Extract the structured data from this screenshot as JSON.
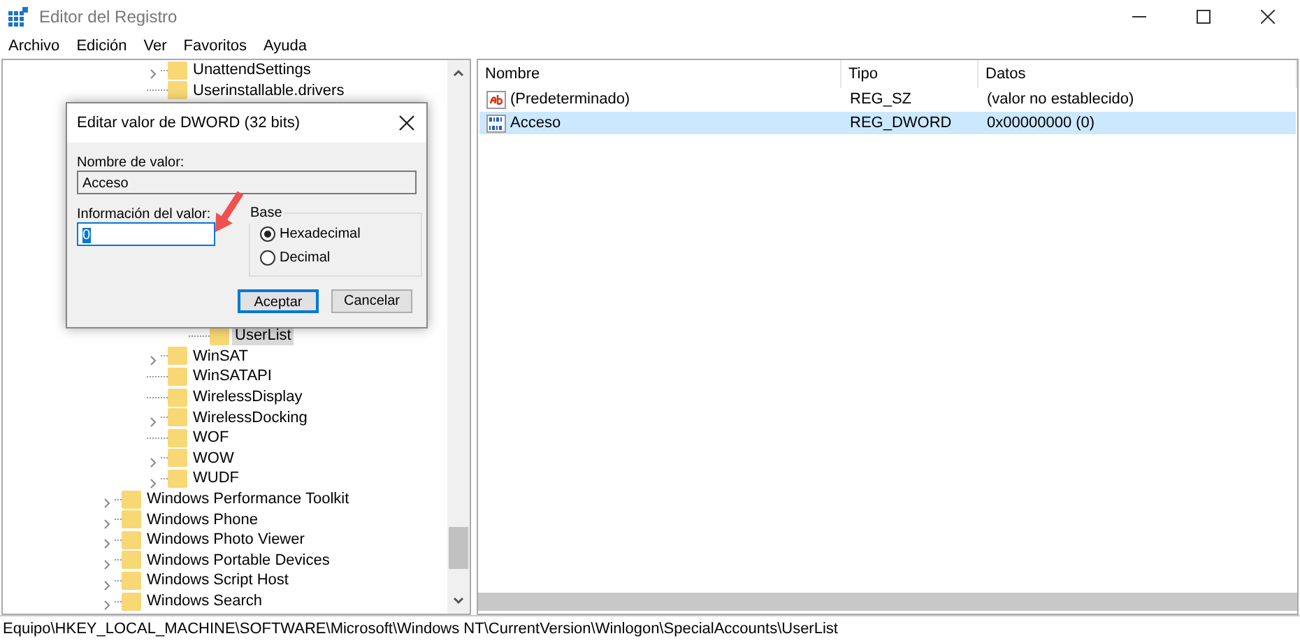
{
  "window": {
    "title": "Editor del Registro"
  },
  "menu": [
    "Archivo",
    "Edición",
    "Ver",
    "Favoritos",
    "Ayuda"
  ],
  "tree": [
    {
      "kind": "group",
      "children": [
        {
          "label": "UnattendSettings",
          "expander": true
        },
        {
          "label": "Userinstallable.drivers",
          "expander": false
        },
        {
          "kind": "group",
          "children": [
            {
              "label": "UserList",
              "expander": false,
              "selected": true
            }
          ]
        },
        {
          "label": "WinSAT",
          "expander": true
        },
        {
          "label": "WinSATAPI",
          "expander": false
        },
        {
          "label": "WirelessDisplay",
          "expander": false
        },
        {
          "label": "WirelessDocking",
          "expander": true
        },
        {
          "label": "WOF",
          "expander": false
        },
        {
          "label": "WOW",
          "expander": true
        },
        {
          "label": "WUDF",
          "expander": true
        }
      ]
    },
    {
      "label": "Windows Performance Toolkit",
      "expander": true
    },
    {
      "label": "Windows Phone",
      "expander": true
    },
    {
      "label": "Windows Photo Viewer",
      "expander": true
    },
    {
      "label": "Windows Portable Devices",
      "expander": true
    },
    {
      "label": "Windows Script Host",
      "expander": true
    },
    {
      "label": "Windows Search",
      "expander": true
    }
  ],
  "table": {
    "columns": [
      "Nombre",
      "Tipo",
      "Datos"
    ],
    "rows": [
      {
        "kind": "string",
        "name": "(Predeterminado)",
        "type": "REG_SZ",
        "data": "(valor no establecido)",
        "selected": false
      },
      {
        "kind": "binary",
        "name": "Acceso",
        "type": "REG_DWORD",
        "data": "0x00000000 (0)",
        "selected": true
      }
    ]
  },
  "dialog": {
    "title": "Editar valor de DWORD (32 bits)",
    "name_label": "Nombre de valor:",
    "name_value": "Acceso",
    "data_label": "Información del valor:",
    "data_value": "0",
    "base_label": "Base",
    "bases": [
      {
        "label": "Hexadecimal",
        "selected": true
      },
      {
        "label": "Decimal",
        "selected": false
      }
    ],
    "buttons": [
      {
        "label": "Aceptar",
        "default": true
      },
      {
        "label": "Cancelar",
        "default": false
      }
    ]
  },
  "status_bar": "Equipo\\HKEY_LOCAL_MACHINE\\SOFTWARE\\Microsoft\\Windows NT\\CurrentVersion\\Winlogon\\SpecialAccounts\\UserList"
}
